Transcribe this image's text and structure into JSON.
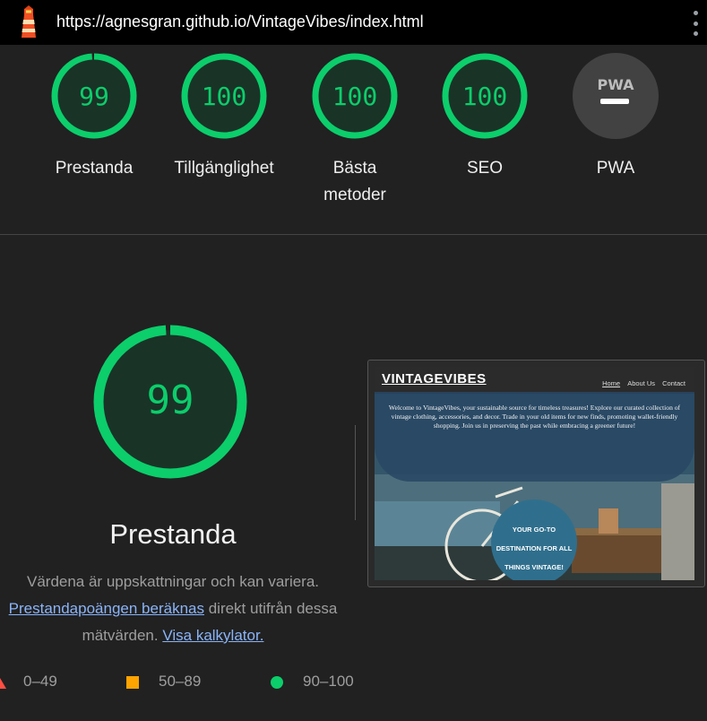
{
  "browser": {
    "url": "https://agnesgran.github.io/VintageVibes/index.html",
    "logo_icon": "lighthouse-icon",
    "menu_icon": "kebab-menu-icon"
  },
  "gauges": [
    {
      "score": "99",
      "label_lines": [
        "Prestanda"
      ],
      "type": "score"
    },
    {
      "score": "100",
      "label_lines": [
        "Tillgänglighet"
      ],
      "type": "score"
    },
    {
      "score": "100",
      "label_lines": [
        "Bästa",
        "metoder"
      ],
      "type": "score"
    },
    {
      "score": "100",
      "label_lines": [
        "SEO"
      ],
      "type": "score"
    },
    {
      "score": "PWA",
      "label_lines": [
        "PWA"
      ],
      "type": "pwa"
    }
  ],
  "performance": {
    "score": "99",
    "title": "Prestanda",
    "desc_text_1": "Värdena är uppskattningar och kan variera.",
    "link_1": "Prestandapoängen beräknas",
    "desc_text_2": " direkt utifrån dessa mätvärden.",
    "link_2": "Visa kalkylator."
  },
  "legend": {
    "fail": "0–49",
    "average": "50–89",
    "pass": "90–100"
  },
  "screenshot": {
    "site_title": "VINTAGEVIBES",
    "nav": [
      "Home",
      "About Us",
      "Contact"
    ],
    "hero_text": "Welcome to VintageVibes, your sustainable source for timeless treasures! Explore our curated collection of vintage clothing, accessories, and decor. Trade in your old items for new finds, promoting wallet-friendly shopping. Join us in preserving the past while embracing a greener future!",
    "badge_lines": [
      "YOUR GO-TO",
      "DESTINATION FOR ALL",
      "THINGS VINTAGE!"
    ]
  },
  "colors": {
    "pass": "#0cce6b",
    "average": "#ffa400",
    "fail": "#ff4e42",
    "background": "#212121",
    "topbar": "#000000"
  }
}
